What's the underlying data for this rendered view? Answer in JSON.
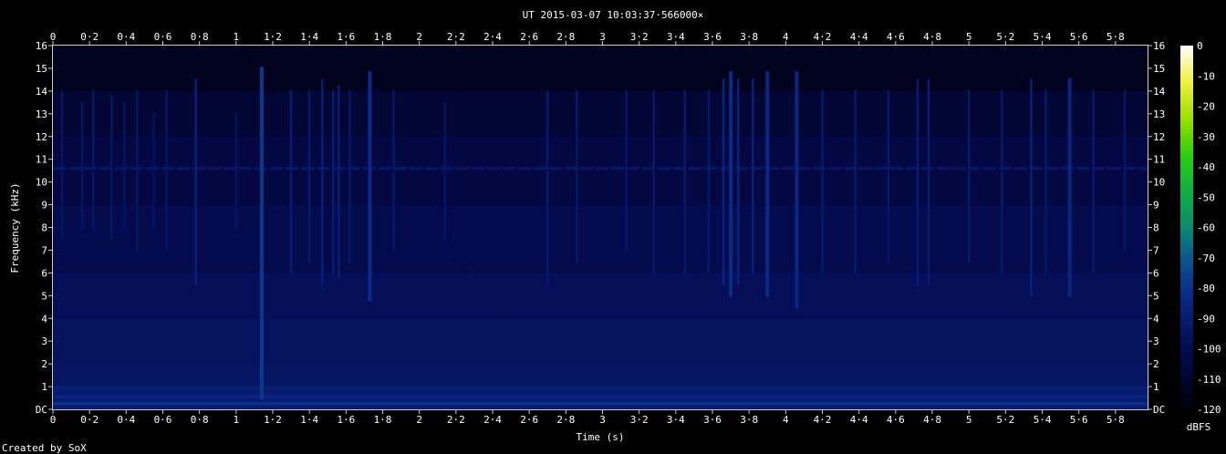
{
  "chart_data": {
    "type": "heatmap",
    "title": "UT 2015-03-07 10:03:37·566000×",
    "xlabel": "Time (s)",
    "ylabel": "Frequency (kHz)",
    "xlim": [
      0,
      5.975
    ],
    "ylim": [
      0,
      16
    ],
    "x_tick_labels": [
      "0",
      "0·2",
      "0·4",
      "0·6",
      "0·8",
      "1",
      "1·2",
      "1·4",
      "1·6",
      "1·8",
      "2",
      "2·2",
      "2·4",
      "2·6",
      "2·8",
      "3",
      "3·2",
      "3·4",
      "3·6",
      "3·8",
      "4",
      "4·2",
      "4·4",
      "4·6",
      "4·8",
      "5",
      "5·2",
      "5·4",
      "5·6",
      "5·8"
    ],
    "y_tick_labels": [
      "DC",
      "1",
      "2",
      "3",
      "4",
      "5",
      "6",
      "7",
      "8",
      "9",
      "10",
      "11",
      "12",
      "13",
      "14",
      "15",
      "16"
    ],
    "colorbar": {
      "label": "dBFS",
      "range": [
        -120,
        0
      ],
      "tick_labels": [
        "0",
        "-10",
        "-20",
        "-30",
        "-40",
        "-50",
        "-60",
        "-70",
        "-80",
        "-90",
        "-100",
        "-110",
        "-120"
      ]
    },
    "features": {
      "carrier_khz": 10.6,
      "noise_floor_dbfs": -100,
      "impulses": [
        {
          "t": 0.05,
          "top": 14.0,
          "bottom": 7.5,
          "level": -95
        },
        {
          "t": 0.16,
          "top": 13.5,
          "bottom": 8.0,
          "level": -95
        },
        {
          "t": 0.22,
          "top": 14.0,
          "bottom": 8.0,
          "level": -94
        },
        {
          "t": 0.32,
          "top": 13.8,
          "bottom": 7.5,
          "level": -94
        },
        {
          "t": 0.39,
          "top": 13.5,
          "bottom": 8.0,
          "level": -95
        },
        {
          "t": 0.46,
          "top": 14.0,
          "bottom": 7.0,
          "level": -94
        },
        {
          "t": 0.55,
          "top": 13.0,
          "bottom": 8.0,
          "level": -96
        },
        {
          "t": 0.62,
          "top": 14.0,
          "bottom": 7.0,
          "level": -95
        },
        {
          "t": 0.78,
          "top": 14.5,
          "bottom": 5.5,
          "level": -88
        },
        {
          "t": 1.0,
          "top": 13.0,
          "bottom": 8.0,
          "level": -96
        },
        {
          "t": 1.14,
          "top": 15.0,
          "bottom": 0.5,
          "level": -78
        },
        {
          "t": 1.3,
          "top": 14.0,
          "bottom": 6.0,
          "level": -90
        },
        {
          "t": 1.4,
          "top": 14.0,
          "bottom": 6.5,
          "level": -92
        },
        {
          "t": 1.47,
          "top": 14.5,
          "bottom": 5.5,
          "level": -89
        },
        {
          "t": 1.53,
          "top": 14.0,
          "bottom": 6.0,
          "level": -90
        },
        {
          "t": 1.56,
          "top": 14.2,
          "bottom": 5.8,
          "level": -89
        },
        {
          "t": 1.62,
          "top": 14.0,
          "bottom": 6.5,
          "level": -92
        },
        {
          "t": 1.73,
          "top": 14.8,
          "bottom": 4.8,
          "level": -82
        },
        {
          "t": 1.86,
          "top": 14.0,
          "bottom": 7.0,
          "level": -94
        },
        {
          "t": 2.14,
          "top": 13.5,
          "bottom": 7.5,
          "level": -95
        },
        {
          "t": 2.7,
          "top": 14.0,
          "bottom": 5.5,
          "level": -92
        },
        {
          "t": 2.86,
          "top": 14.0,
          "bottom": 6.5,
          "level": -93
        },
        {
          "t": 3.13,
          "top": 14.0,
          "bottom": 7.0,
          "level": -94
        },
        {
          "t": 3.28,
          "top": 14.0,
          "bottom": 6.0,
          "level": -93
        },
        {
          "t": 3.45,
          "top": 14.0,
          "bottom": 6.0,
          "level": -93
        },
        {
          "t": 3.58,
          "top": 14.0,
          "bottom": 6.0,
          "level": -92
        },
        {
          "t": 3.66,
          "top": 14.5,
          "bottom": 5.5,
          "level": -86
        },
        {
          "t": 3.7,
          "top": 14.8,
          "bottom": 5.0,
          "level": -82
        },
        {
          "t": 3.74,
          "top": 14.5,
          "bottom": 5.5,
          "level": -86
        },
        {
          "t": 3.82,
          "top": 14.5,
          "bottom": 6.0,
          "level": -88
        },
        {
          "t": 3.9,
          "top": 14.8,
          "bottom": 5.0,
          "level": -83
        },
        {
          "t": 4.06,
          "top": 14.8,
          "bottom": 4.5,
          "level": -84
        },
        {
          "t": 4.2,
          "top": 14.0,
          "bottom": 6.0,
          "level": -92
        },
        {
          "t": 4.38,
          "top": 14.0,
          "bottom": 6.0,
          "level": -92
        },
        {
          "t": 4.56,
          "top": 14.0,
          "bottom": 6.5,
          "level": -93
        },
        {
          "t": 4.72,
          "top": 14.5,
          "bottom": 5.5,
          "level": -90
        },
        {
          "t": 4.78,
          "top": 14.5,
          "bottom": 5.5,
          "level": -90
        },
        {
          "t": 5.0,
          "top": 14.0,
          "bottom": 6.5,
          "level": -93
        },
        {
          "t": 5.18,
          "top": 14.0,
          "bottom": 6.0,
          "level": -93
        },
        {
          "t": 5.34,
          "top": 14.5,
          "bottom": 5.0,
          "level": -88
        },
        {
          "t": 5.42,
          "top": 14.0,
          "bottom": 6.0,
          "level": -92
        },
        {
          "t": 5.55,
          "top": 14.5,
          "bottom": 5.0,
          "level": -85
        },
        {
          "t": 5.68,
          "top": 14.0,
          "bottom": 6.0,
          "level": -92
        },
        {
          "t": 5.85,
          "top": 14.0,
          "bottom": 7.0,
          "level": -94
        }
      ]
    }
  },
  "footer": {
    "credit": "Created by SoX"
  }
}
